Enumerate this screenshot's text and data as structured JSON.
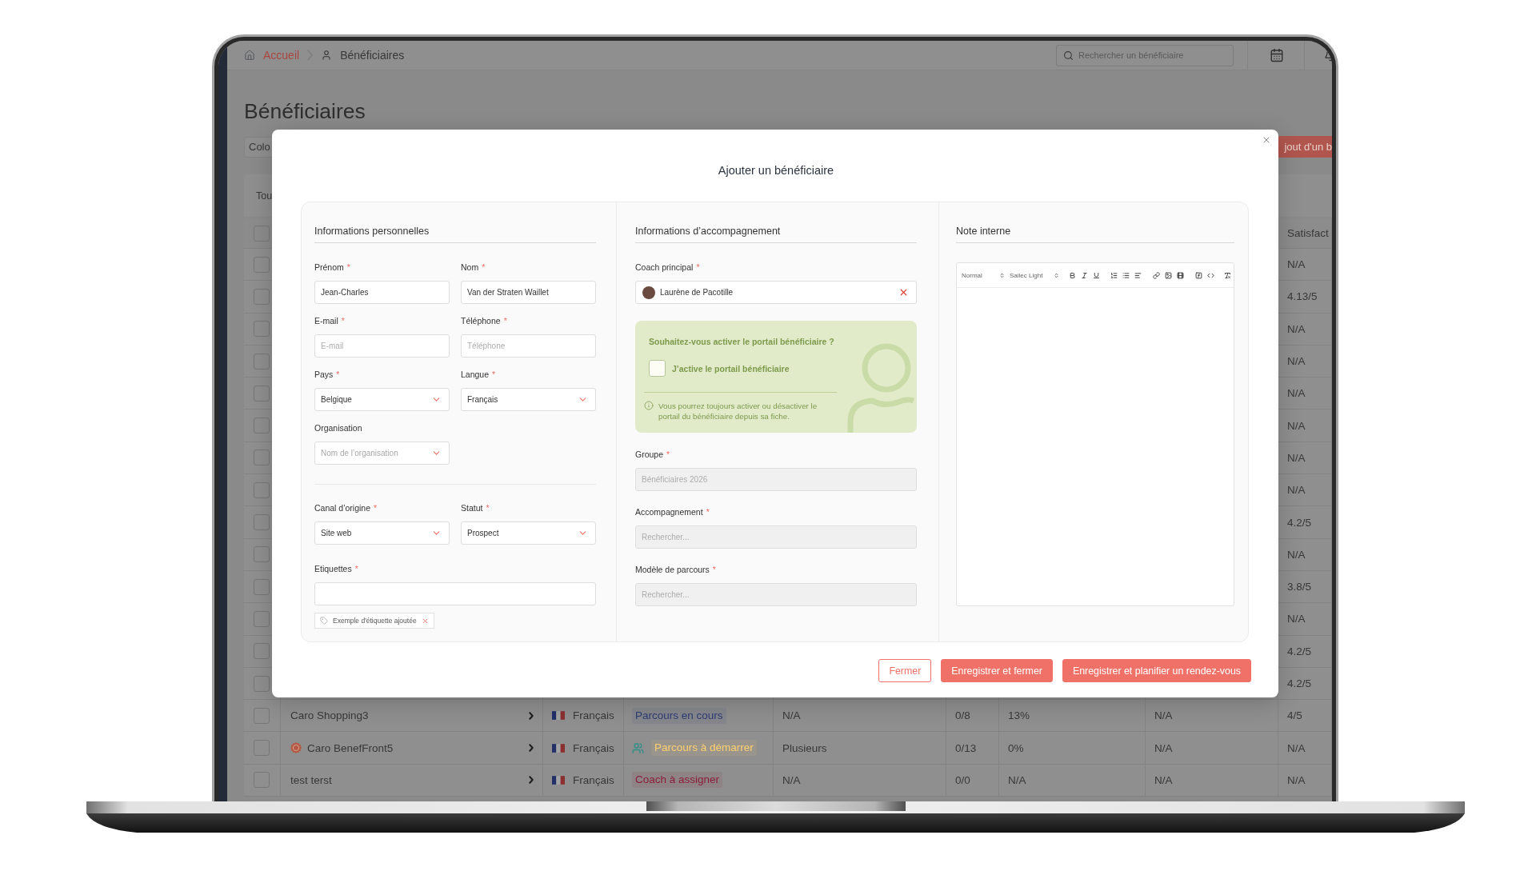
{
  "topbar": {
    "breadcrumb": [
      {
        "label": "Accueil",
        "selected": false
      },
      {
        "label": "Bénéficiaires",
        "selected": true
      }
    ],
    "search": {
      "placeholder": "Rechercher un bénéficiaire"
    }
  },
  "page": {
    "title": "Bénéficiaires",
    "dropdown": "Colo",
    "action_button": "jout d'un b",
    "tab": "Tou"
  },
  "table": {
    "header": {
      "checked": false,
      "column_9": "Satisfact"
    },
    "rows": [
      {
        "checked": false,
        "column_9": "N/A"
      },
      {
        "checked": false,
        "column_9": "4.13/5"
      },
      {
        "checked": false,
        "column_9": "N/A"
      },
      {
        "checked": false,
        "column_9": "N/A"
      },
      {
        "checked": false,
        "column_9": "N/A"
      },
      {
        "checked": false,
        "column_9": "N/A"
      },
      {
        "checked": false,
        "column_9": "N/A"
      },
      {
        "checked": false,
        "column_9": "N/A"
      },
      {
        "checked": false,
        "column_9": "4.2/5"
      },
      {
        "checked": false,
        "column_9": "N/A"
      },
      {
        "checked": false,
        "column_9": "3.8/5"
      },
      {
        "checked": false,
        "column_9": "N/A"
      },
      {
        "checked": false,
        "column_9": "4.2/5"
      },
      {
        "checked": false,
        "column_9": "4.2/5"
      },
      {
        "checked": false,
        "name_icon": false,
        "column_2": "Caro Shopping3",
        "column_3": "Français",
        "column_4": {
          "label": "Parcours en cours",
          "color": "#2d3c72",
          "icon": false
        },
        "column_5": "N/A",
        "column_6": "0/8",
        "column_7": "13%",
        "column_8": "N/A",
        "column_9": "4/5"
      },
      {
        "checked": false,
        "name_icon": true,
        "column_2": "Caro BenefFront5",
        "column_3": "Français",
        "column_4": {
          "label": "Parcours à démarrer",
          "color": "#ffd070",
          "icon": true
        },
        "column_5": "Plusieurs",
        "column_6": "0/13",
        "column_7": "0%",
        "column_8": "N/A",
        "column_9": "N/A"
      },
      {
        "checked": false,
        "name_icon": false,
        "column_2": "test terst",
        "column_3": "Français",
        "column_4": {
          "label": "Coach à assigner",
          "color": "#8a1d3a",
          "icon": false
        },
        "column_5": "N/A",
        "column_6": "0/0",
        "column_7": "N/A",
        "column_8": "N/A",
        "column_9": "N/A"
      }
    ]
  },
  "modal": {
    "title": "Ajouter un bénéficiaire",
    "personal": {
      "title": "Informations personnelles",
      "groups": [
        [
          {
            "kind": "text",
            "label": "Prénom",
            "required_mark": "*",
            "value": "Jean-Charles"
          },
          {
            "kind": "text",
            "label": "Nom",
            "required_mark": "*",
            "value": "Van der Straten Waillet"
          },
          {
            "kind": "text",
            "label": "E-mail",
            "required_mark": "*",
            "placeholder": "E-mail"
          },
          {
            "kind": "text",
            "label": "Téléphone",
            "required_mark": "*",
            "placeholder": "Téléphone"
          },
          {
            "kind": "select",
            "label": "Pays",
            "required_mark": "*",
            "value": "Belgique"
          },
          {
            "kind": "select",
            "label": "Langue",
            "required_mark": "*",
            "value": "Français"
          },
          {
            "kind": "select",
            "label": "Organisation",
            "placeholder": "Nom de l’organisation"
          }
        ],
        [
          {
            "kind": "select",
            "label": "Canal d’origine",
            "required_mark": "*",
            "value": "Site web"
          },
          {
            "kind": "select",
            "label": "Statut",
            "required_mark": "*",
            "value": "Prospect"
          },
          {
            "kind": "tags",
            "label": "Etiquettes",
            "required_mark": "*",
            "tags": [
              "Exemple d'étiquette ajoutée"
            ]
          }
        ]
      ]
    },
    "coaching": {
      "title": "Informations d’accompagnement",
      "coach": {
        "label": "Coach principal",
        "required_mark": "*",
        "value": "Laurène de Pacotille"
      },
      "portal": {
        "title": "Souhaitez-vous activer le portail bénéficiaire ?",
        "checkbox": {
          "label": "J’active le portail bénéficiaire",
          "checked": false
        },
        "note": "Vous pourrez toujours activer ou désactiver le portail du bénéficiaire depuis sa fiche."
      },
      "fields": [
        {
          "label": "Groupe",
          "required_mark": "*",
          "placeholder": "Bénéficiaires 2026",
          "disabled": true
        },
        {
          "label": "Accompagnement",
          "required_mark": "*",
          "placeholder": "Rechercher...",
          "disabled": true
        },
        {
          "label": "Modèle de parcours",
          "required_mark": "*",
          "placeholder": "Rechercher...",
          "disabled": true
        }
      ]
    },
    "note": {
      "title": "Note interne",
      "editor": {
        "format": "Normal",
        "font": "Sailec Light"
      }
    },
    "buttons": [
      {
        "label": "Fermer",
        "kind": "outline"
      },
      {
        "label": "Enregistrer et fermer",
        "kind": "primary"
      },
      {
        "label": "Enregistrer et planifier un rendez-vous",
        "kind": "primary"
      }
    ]
  }
}
